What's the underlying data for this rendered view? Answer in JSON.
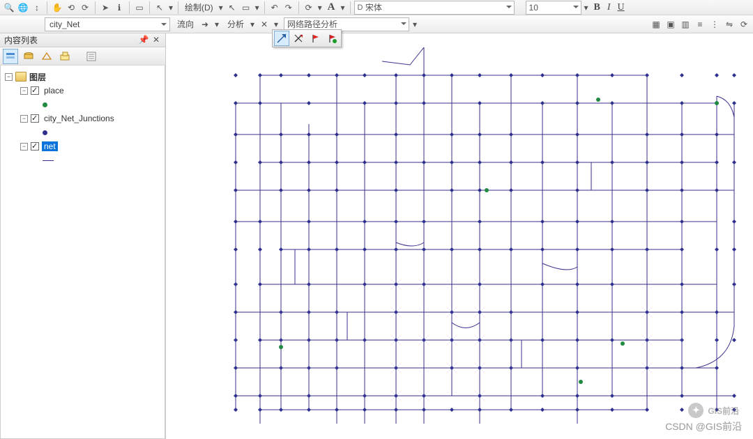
{
  "toolbars": {
    "draw_label": "绘制(D)",
    "font_placeholder": "宋体",
    "font_size": "10",
    "bold": "B",
    "italic": "I",
    "underline": "U",
    "textA": "A"
  },
  "row2": {
    "layer_combo": "city_Net",
    "flow_label": "流向",
    "analysis_label": "分析",
    "network_path_label": "网络路径分析"
  },
  "toc": {
    "title": "内容列表",
    "root_label": "图层",
    "layers": [
      {
        "name": "place",
        "symbol": "point",
        "color": "#1f8a40"
      },
      {
        "name": "city_Net_Junctions",
        "symbol": "point",
        "color": "#2f2f8e"
      },
      {
        "name": "net",
        "symbol": "line",
        "color": "#3a2f8b",
        "selected": true
      }
    ]
  },
  "watermark": {
    "name": "GIS前沿",
    "csdn": "CSDN @GIS前沿"
  },
  "float_tools": [
    "network-flag-tool",
    "remove-flag-tool",
    "red-flag-tool",
    "green-flag-tool"
  ]
}
